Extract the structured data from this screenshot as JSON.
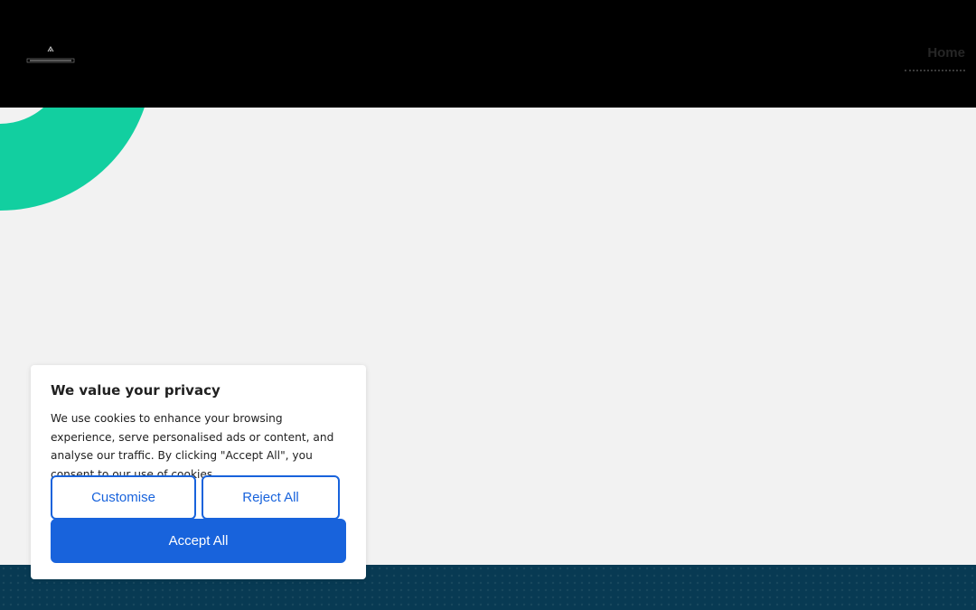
{
  "header": {
    "logo_icon": "brand-logo-icon",
    "nav": {
      "home_label": "Home"
    }
  },
  "hero": {
    "accent_color": "#12cfa0"
  },
  "cookie_banner": {
    "title": "We value your privacy",
    "body": "We use cookies to enhance your browsing experience, serve personalised ads or content, and analyse our traffic. By clicking \"Accept All\", you consent to our use of cookies.",
    "customise_label": "Customise",
    "reject_label": "Reject All",
    "accept_label": "Accept All",
    "button_color": "#1863dc"
  },
  "footer": {
    "band_color": "#083a53"
  }
}
